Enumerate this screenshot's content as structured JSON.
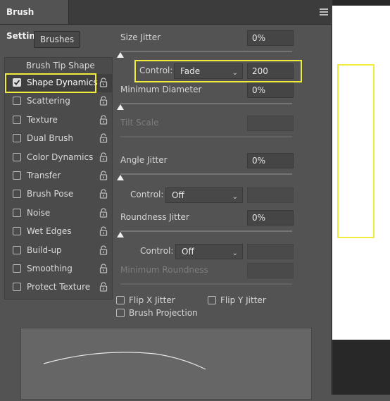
{
  "panel": {
    "title": "Brush Settings",
    "brushes_button": "Brushes",
    "tip_shape_label": "Brush Tip Shape",
    "items": [
      {
        "label": "Shape Dynamics",
        "checked": true
      },
      {
        "label": "Scattering",
        "checked": false
      },
      {
        "label": "Texture",
        "checked": false
      },
      {
        "label": "Dual Brush",
        "checked": false
      },
      {
        "label": "Color Dynamics",
        "checked": false
      },
      {
        "label": "Transfer",
        "checked": false
      },
      {
        "label": "Brush Pose",
        "checked": false
      },
      {
        "label": "Noise",
        "checked": false
      },
      {
        "label": "Wet Edges",
        "checked": false
      },
      {
        "label": "Build-up",
        "checked": false
      },
      {
        "label": "Smoothing",
        "checked": false
      },
      {
        "label": "Protect Texture",
        "checked": false
      }
    ]
  },
  "settings": {
    "size_jitter": {
      "label": "Size Jitter",
      "value": "0%"
    },
    "size_control": {
      "label": "Control:",
      "option": "Fade",
      "value": "200"
    },
    "min_diameter": {
      "label": "Minimum Diameter",
      "value": "0%"
    },
    "tilt_scale": {
      "label": "Tilt Scale"
    },
    "angle_jitter": {
      "label": "Angle Jitter",
      "value": "0%"
    },
    "angle_control": {
      "label": "Control:",
      "option": "Off"
    },
    "roundness_jitter": {
      "label": "Roundness Jitter",
      "value": "0%"
    },
    "roundness_control": {
      "label": "Control:",
      "option": "Off"
    },
    "min_roundness": {
      "label": "Minimum Roundness"
    },
    "flip_x": "Flip X Jitter",
    "flip_y": "Flip Y Jitter",
    "brush_projection": "Brush Projection"
  },
  "colors": {
    "highlight": "#f0ec3e",
    "panel": "#535353"
  }
}
